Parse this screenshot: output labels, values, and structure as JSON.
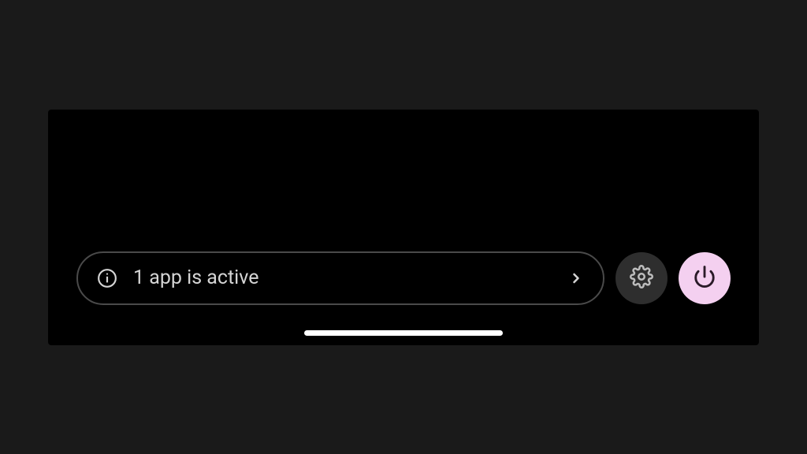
{
  "footer": {
    "active_apps_label": "1 app is active"
  },
  "icons": {
    "info": "info-icon",
    "chevron": "chevron-right-icon",
    "settings": "gear-icon",
    "power": "power-icon"
  },
  "colors": {
    "panel_bg": "#000000",
    "page_bg": "#1a1a1a",
    "pill_border": "#4a4a4a",
    "text": "#d5d5d5",
    "settings_bg": "#2e2e2e",
    "power_bg": "#f4d0f0",
    "power_icon": "#2a1a28"
  }
}
